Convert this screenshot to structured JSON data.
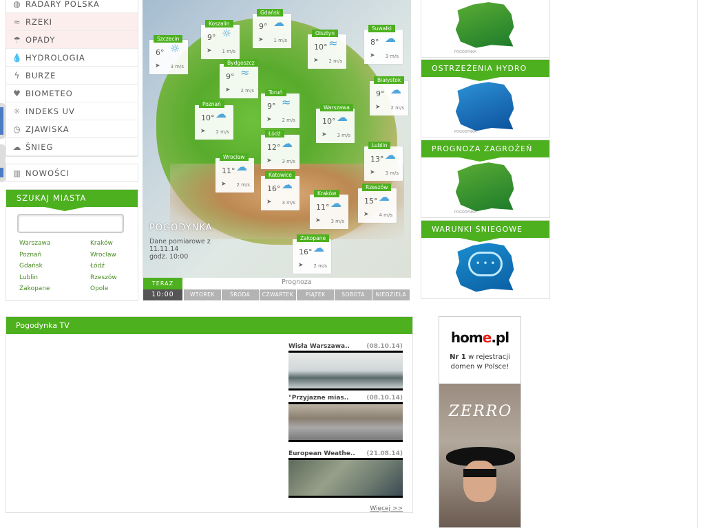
{
  "menu": {
    "items": [
      {
        "label": "RADARY POLSKA",
        "icon": "globe-icon",
        "glyph": "◍"
      },
      {
        "label": "RZEKI",
        "icon": "river-icon",
        "glyph": "≈"
      },
      {
        "label": "OPADY",
        "icon": "umbrella-icon",
        "glyph": "☂"
      },
      {
        "label": "HYDROLOGIA",
        "icon": "drop-icon",
        "glyph": "💧"
      },
      {
        "label": "BURZE",
        "icon": "lightning-icon",
        "glyph": "ϟ"
      },
      {
        "label": "BIOMETEO",
        "icon": "heart-icon",
        "glyph": "♥"
      },
      {
        "label": "INDEKS UV",
        "icon": "sun-icon",
        "glyph": "☼"
      },
      {
        "label": "ZJAWISKA",
        "icon": "clock-icon",
        "glyph": "◷"
      },
      {
        "label": "ŚNIEG",
        "icon": "snow-cloud-icon",
        "glyph": "☁"
      }
    ],
    "news": {
      "label": "NOWOŚCI",
      "icon": "book-icon",
      "glyph": "▥"
    }
  },
  "search": {
    "title": "SZUKAJ MIASTA",
    "placeholder": "",
    "cities": [
      "Warszawa",
      "Kraków",
      "Poznań",
      "Wrocław",
      "Gdańsk",
      "Łódź",
      "Lublin",
      "Rzeszów",
      "Zakopane",
      "Opole"
    ]
  },
  "map": {
    "logo": "POGODYNKA",
    "measure_label": "Dane pomiarowe z",
    "date": "11.11.14",
    "time_label": "godz. 10:00",
    "unit": "m/s",
    "cities": [
      {
        "name": "Szczecin",
        "temp": "6°",
        "wind": "3"
      },
      {
        "name": "Koszalin",
        "temp": "9°",
        "wind": "1"
      },
      {
        "name": "Gdańsk",
        "temp": "9°",
        "wind": "1"
      },
      {
        "name": "Olsztyn",
        "temp": "10°",
        "wind": "2"
      },
      {
        "name": "Suwałki",
        "temp": "8°",
        "wind": "3"
      },
      {
        "name": "Bydgoszcz",
        "temp": "9°",
        "wind": "2"
      },
      {
        "name": "Białystok",
        "temp": "9°",
        "wind": "2"
      },
      {
        "name": "Toruń",
        "temp": "9°",
        "wind": "2"
      },
      {
        "name": "Poznań",
        "temp": "10°",
        "wind": "2"
      },
      {
        "name": "Warszawa",
        "temp": "10°",
        "wind": "3"
      },
      {
        "name": "Łódź",
        "temp": "12°",
        "wind": "3"
      },
      {
        "name": "Lublin",
        "temp": "13°",
        "wind": "3"
      },
      {
        "name": "Wrocław",
        "temp": "11°",
        "wind": "2"
      },
      {
        "name": "Katowice",
        "temp": "16°",
        "wind": "3"
      },
      {
        "name": "Kraków",
        "temp": "11°",
        "wind": "3"
      },
      {
        "name": "Rzeszów",
        "temp": "15°",
        "wind": "4"
      },
      {
        "name": "Zakopane",
        "temp": "16°",
        "wind": "2"
      }
    ]
  },
  "timebar": {
    "now_label": "TERAZ",
    "now_time": "10:00",
    "forecast_label": "Prognoza",
    "days": [
      "WTOREK",
      "ŚRODA",
      "CZWARTEK",
      "PIĄTEK",
      "SOBOTA",
      "NIEDZIELA"
    ]
  },
  "right_panels": [
    {
      "title": "",
      "map": "poland-green-map"
    },
    {
      "title": "OSTRZEŻENIA HYDRO",
      "map": "poland-blue-map"
    },
    {
      "title": "PROGNOZA ZAGROŻEŃ",
      "map": "poland-green-map"
    },
    {
      "title": "WARUNKI ŚNIEGOWE",
      "map": "poland-snow-map"
    }
  ],
  "tv": {
    "title": "Pogodynka TV",
    "videos": [
      {
        "title": "Wisła Warszawa..",
        "date": "(08.10.14)"
      },
      {
        "title": "\"Przyjazne mias..",
        "date": "(08.10.14)"
      },
      {
        "title": "European Weathe..",
        "date": "(21.08.14)"
      }
    ],
    "more": "Więcej >>"
  },
  "ad": {
    "brand_a": "hom",
    "brand_b": "e",
    "brand_c": ".pl",
    "nr": "Nr 1",
    "text": "w rejestracji domen w Polsce!",
    "product": "ZERRO"
  },
  "colors": {
    "accent": "#4db01e",
    "link": "#4a8b24"
  }
}
